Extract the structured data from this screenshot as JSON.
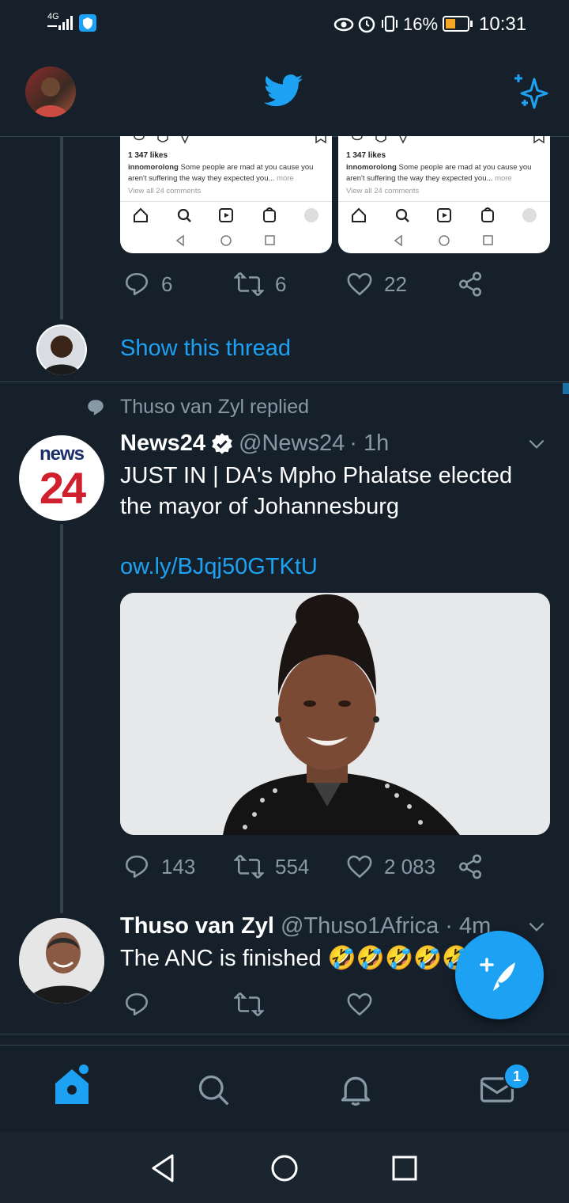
{
  "status_bar": {
    "network": "4G",
    "battery_percent": "16%",
    "time": "10:31"
  },
  "top_bar": {
    "logo_icon": "twitter-bird-icon",
    "sparkle_icon": "sparkle-icon"
  },
  "embedded_cards": [
    {
      "likes": "1 347 likes",
      "username": "innomorolong",
      "caption": "Some people are mad at you cause you aren't suffering the way they expected you...",
      "more": "more",
      "comments": "View all 24 comments"
    },
    {
      "likes": "1 347 likes",
      "username": "innomorolong",
      "caption": "Some people are mad at you cause you aren't suffering the way they expected you...",
      "more": "more",
      "comments": "View all 24 comments"
    }
  ],
  "tweet1": {
    "replies": "6",
    "retweets": "6",
    "likes": "22"
  },
  "thread_link": "Show this thread",
  "reply_context": "Thuso van Zyl replied",
  "tweet2": {
    "logo_top": "news",
    "logo_bottom": "24",
    "name": "News24",
    "handle": "@News24",
    "time": "· 1h",
    "text_line1": "JUST IN | DA's Mpho Phalatse elected",
    "text_line2": "the mayor of Johannesburg",
    "link": "ow.ly/BJqj50GTKtU",
    "replies": "143",
    "retweets": "554",
    "likes": "2 083"
  },
  "tweet3": {
    "name": "Thuso van Zyl",
    "handle": "@Thuso1Africa",
    "time": "· 4m",
    "text": "The ANC is finished",
    "emoji": "🤣🤣🤣🤣🤣"
  },
  "bottom_nav": {
    "messages_badge": "1"
  },
  "colors": {
    "background": "#15202b",
    "accent": "#1da1f2",
    "muted": "#8899a6",
    "border": "#38444d"
  }
}
